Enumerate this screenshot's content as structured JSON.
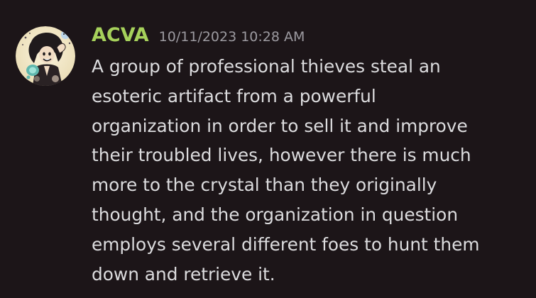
{
  "message": {
    "author": "ACVA",
    "timestamp": "10/11/2023 10:28 AM",
    "lines": [
      "A group of professional thieves steal an",
      "esoteric artifact from a powerful",
      "organization in order to sell it and improve",
      "their troubled lives, however there is much",
      "more to the crystal than they originally",
      "thought, and the organization in question",
      "employs several different foes to hunt them",
      "down and retrieve it."
    ]
  },
  "colors": {
    "background": "#1c1518",
    "username": "#a6d15b",
    "timestamp": "#9c9aa0",
    "text": "#dcdcde"
  }
}
